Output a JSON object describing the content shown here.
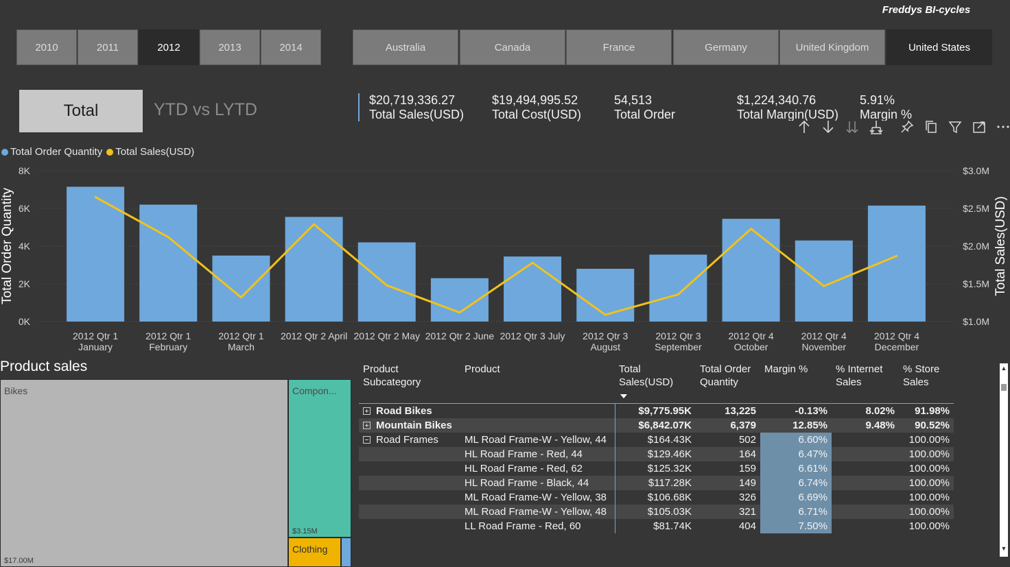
{
  "brand": "Freddys BI-cycles",
  "years": [
    {
      "label": "2010",
      "selected": false
    },
    {
      "label": "2011",
      "selected": false
    },
    {
      "label": "2012",
      "selected": true
    },
    {
      "label": "2013",
      "selected": false
    },
    {
      "label": "2014",
      "selected": false
    }
  ],
  "countries": [
    {
      "label": "Australia",
      "selected": false
    },
    {
      "label": "Canada",
      "selected": false
    },
    {
      "label": "France",
      "selected": false
    },
    {
      "label": "Germany",
      "selected": false
    },
    {
      "label": "United Kingdom",
      "selected": false
    },
    {
      "label": "United States",
      "selected": true
    }
  ],
  "total_button": "Total",
  "ytd_label": "YTD vs LYTD",
  "kpis": [
    {
      "value": "$20,719,336.27",
      "label": "Total Sales(USD)"
    },
    {
      "value": "$19,494,995.52",
      "label": "Total Cost(USD)"
    },
    {
      "value": "54,513",
      "label": "Total Order"
    },
    {
      "value": "$1,224,340.76",
      "label": "Total Margin(USD)"
    },
    {
      "value": "5.91%",
      "label": "Margin %"
    }
  ],
  "legend": [
    {
      "label": "Total Order Quantity",
      "color": "#6fa8dc"
    },
    {
      "label": "Total Sales(USD)",
      "color": "#f2c21b"
    }
  ],
  "chart_data": {
    "type": "bar",
    "categories": [
      [
        "2012 Qtr 1",
        "January"
      ],
      [
        "2012 Qtr 1",
        "February"
      ],
      [
        "2012 Qtr 1",
        "March"
      ],
      [
        "2012 Qtr 2 April"
      ],
      [
        "2012 Qtr 2 May"
      ],
      [
        "2012 Qtr 2 June"
      ],
      [
        "2012 Qtr 3 July"
      ],
      [
        "2012 Qtr 3",
        "August"
      ],
      [
        "2012 Qtr 3",
        "September"
      ],
      [
        "2012 Qtr 4",
        "October"
      ],
      [
        "2012 Qtr 4",
        "November"
      ],
      [
        "2012 Qtr 4",
        "December"
      ]
    ],
    "series": [
      {
        "name": "Total Order Quantity",
        "axis": "left",
        "color": "#6fa8dc",
        "values": [
          7150,
          6200,
          3500,
          5550,
          4200,
          2300,
          3450,
          2800,
          3550,
          5450,
          4300,
          6150
        ]
      },
      {
        "name": "Total Sales(USD)",
        "axis": "right",
        "color": "#f2c21b",
        "values": [
          2650000,
          2120000,
          1320000,
          2290000,
          1480000,
          1120000,
          1780000,
          1090000,
          1360000,
          2230000,
          1470000,
          1870000
        ]
      }
    ],
    "ylabel": "Total Order Quantity",
    "y2label": "Total Sales(USD)",
    "ylim": [
      0,
      8000
    ],
    "y2lim": [
      1000000,
      3000000
    ],
    "yticks": [
      "0K",
      "2K",
      "4K",
      "6K",
      "8K"
    ],
    "y2ticks": [
      "$1.0M",
      "$1.5M",
      "$2.0M",
      "$2.5M",
      "$3.0M"
    ],
    "grid": true,
    "legend_position": "top-left"
  },
  "section_title": "Product sales",
  "treemap": [
    {
      "label": "Bikes",
      "value": "$17.00M",
      "color": "#b5b5b5"
    },
    {
      "label": "Compon...",
      "value": "$3.15M",
      "color": "#4fbfa8"
    },
    {
      "label": "Clothing",
      "value": "",
      "color": "#f0b400"
    },
    {
      "label": "",
      "value": "",
      "color": "#6fa8dc"
    }
  ],
  "table": {
    "headers": [
      "Product Subcategory",
      "Product",
      "Total Sales(USD)",
      "Total Order Quantity",
      "Margin %",
      "% Internet Sales",
      "% Store Sales"
    ],
    "rows": [
      {
        "subcategory": "Road Bikes",
        "expand": "plus",
        "product": "",
        "sales": "$9,775.95K",
        "qty": "13,225",
        "margin": "-0.13%",
        "internet": "8.02%",
        "store": "91.98%",
        "bold": true,
        "alt": false
      },
      {
        "subcategory": "Mountain Bikes",
        "expand": "plus",
        "product": "",
        "sales": "$6,842.07K",
        "qty": "6,379",
        "margin": "12.85%",
        "internet": "9.48%",
        "store": "90.52%",
        "bold": true,
        "alt": true
      },
      {
        "subcategory": "Road Frames",
        "expand": "minus",
        "product": "ML Road Frame-W - Yellow, 44",
        "sales": "$164.43K",
        "qty": "502",
        "margin": "6.60%",
        "internet": "",
        "store": "100.00%",
        "bold": false,
        "alt": false
      },
      {
        "subcategory": "",
        "expand": "",
        "product": "HL Road Frame - Red, 44",
        "sales": "$129.46K",
        "qty": "164",
        "margin": "6.47%",
        "internet": "",
        "store": "100.00%",
        "bold": false,
        "alt": true
      },
      {
        "subcategory": "",
        "expand": "",
        "product": "HL Road Frame - Red, 62",
        "sales": "$125.32K",
        "qty": "159",
        "margin": "6.61%",
        "internet": "",
        "store": "100.00%",
        "bold": false,
        "alt": false
      },
      {
        "subcategory": "",
        "expand": "",
        "product": "HL Road Frame - Black, 44",
        "sales": "$117.28K",
        "qty": "149",
        "margin": "6.74%",
        "internet": "",
        "store": "100.00%",
        "bold": false,
        "alt": true
      },
      {
        "subcategory": "",
        "expand": "",
        "product": "ML Road Frame-W - Yellow, 38",
        "sales": "$106.68K",
        "qty": "326",
        "margin": "6.69%",
        "internet": "",
        "store": "100.00%",
        "bold": false,
        "alt": false
      },
      {
        "subcategory": "",
        "expand": "",
        "product": "ML Road Frame-W - Yellow, 48",
        "sales": "$105.03K",
        "qty": "321",
        "margin": "6.71%",
        "internet": "",
        "store": "100.00%",
        "bold": false,
        "alt": true
      },
      {
        "subcategory": "",
        "expand": "",
        "product": "LL Road Frame - Red, 60",
        "sales": "$81.74K",
        "qty": "404",
        "margin": "7.50%",
        "internet": "",
        "store": "100.00%",
        "bold": false,
        "alt": false
      }
    ]
  },
  "toolbar_icons": [
    "arrow-up-icon",
    "arrow-down-icon",
    "double-arrow-down-icon",
    "expand-hierarchy-icon",
    "pin-icon",
    "copy-icon",
    "filter-icon",
    "focus-mode-icon",
    "more-options-icon"
  ]
}
